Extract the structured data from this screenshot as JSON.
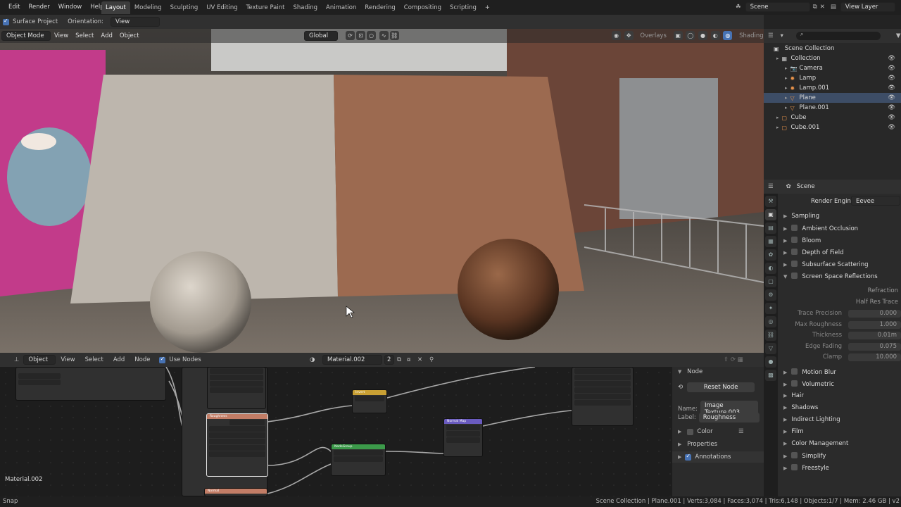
{
  "menu": [
    "Edit",
    "Render",
    "Window",
    "Help"
  ],
  "workspaces": [
    "Layout",
    "Modeling",
    "Sculpting",
    "UV Editing",
    "Texture Paint",
    "Shading",
    "Animation",
    "Rendering",
    "Compositing",
    "Scripting"
  ],
  "active_workspace": "Layout",
  "top_right": {
    "scene": "Scene",
    "view_layer": "View Layer"
  },
  "toolheader": {
    "surface_project": "Surface Project",
    "orientation_label": "Orientation:",
    "orientation_value": "View"
  },
  "viewport": {
    "mode": "Object Mode",
    "view": "View",
    "select": "Select",
    "add": "Add",
    "object": "Object",
    "transform": "Global",
    "overlays": "Overlays",
    "shading": "Shading"
  },
  "outliner": {
    "root": "Scene Collection",
    "items": [
      {
        "label": "Collection",
        "color": "#c9c9c9"
      },
      {
        "label": "Camera",
        "color": "#e8934a"
      },
      {
        "label": "Lamp",
        "color": "#e8934a"
      },
      {
        "label": "Lamp.001",
        "color": "#e8934a"
      },
      {
        "label": "Plane",
        "color": "#e8934a"
      },
      {
        "label": "Plane.001",
        "color": "#e8934a"
      },
      {
        "label": "Cube",
        "color": "#e8934a"
      },
      {
        "label": "Cube.001",
        "color": "#e8934a"
      }
    ]
  },
  "node_editor": {
    "editor": "Object",
    "view": "View",
    "select": "Select",
    "add": "Add",
    "node": "Node",
    "use_nodes": "Use Nodes",
    "material": "Material.002",
    "users": "2",
    "corner_label": "Material.002"
  },
  "node_panel": {
    "title": "Node",
    "reset": "Reset Node",
    "name_label": "Name:",
    "name_value": "Image Texture.003",
    "label_label": "Label:",
    "label_value": "Roughness",
    "color": "Color",
    "properties": "Properties",
    "annotations": "Annotations"
  },
  "properties": {
    "scene": "Scene",
    "engine_label": "Render Engine",
    "engine_value": "Eevee",
    "sections_top": [
      {
        "label": "Sampling",
        "checkbox": false
      },
      {
        "label": "Ambient Occlusion",
        "checkbox": true
      },
      {
        "label": "Bloom",
        "checkbox": true
      },
      {
        "label": "Depth of Field",
        "checkbox": true
      },
      {
        "label": "Subsurface Scattering",
        "checkbox": true
      },
      {
        "label": "Screen Space Reflections",
        "checkbox": true
      }
    ],
    "ssr_toggles": [
      "Refraction",
      "Half Res Trace"
    ],
    "ssr_fields": [
      {
        "label": "Trace Precision",
        "value": "0.000"
      },
      {
        "label": "Max Roughness",
        "value": "1.000"
      },
      {
        "label": "Thickness",
        "value": "0.01m"
      },
      {
        "label": "Edge Fading",
        "value": "0.075"
      },
      {
        "label": "Clamp",
        "value": "10.000"
      }
    ],
    "sections_bottom": [
      {
        "label": "Motion Blur",
        "checkbox": true
      },
      {
        "label": "Volumetric",
        "checkbox": true
      },
      {
        "label": "Hair",
        "checkbox": false
      },
      {
        "label": "Shadows",
        "checkbox": false
      },
      {
        "label": "Indirect Lighting",
        "checkbox": false
      },
      {
        "label": "Film",
        "checkbox": false
      },
      {
        "label": "Color Management",
        "checkbox": false
      },
      {
        "label": "Simplify",
        "checkbox": true
      },
      {
        "label": "Freestyle",
        "checkbox": true
      }
    ]
  },
  "nodes": {
    "invert": "Invert",
    "normal_map": "Normal Map",
    "roughness": "Roughness",
    "node_group": "NodeGroup",
    "normal": "Normal"
  },
  "status": {
    "left": "Snap",
    "right": "Scene Collection | Plane.001 | Verts:3,084 | Faces:3,074 | Tris:6,148 | Objects:1/7 | Mem: 2.46 GB | v2"
  }
}
